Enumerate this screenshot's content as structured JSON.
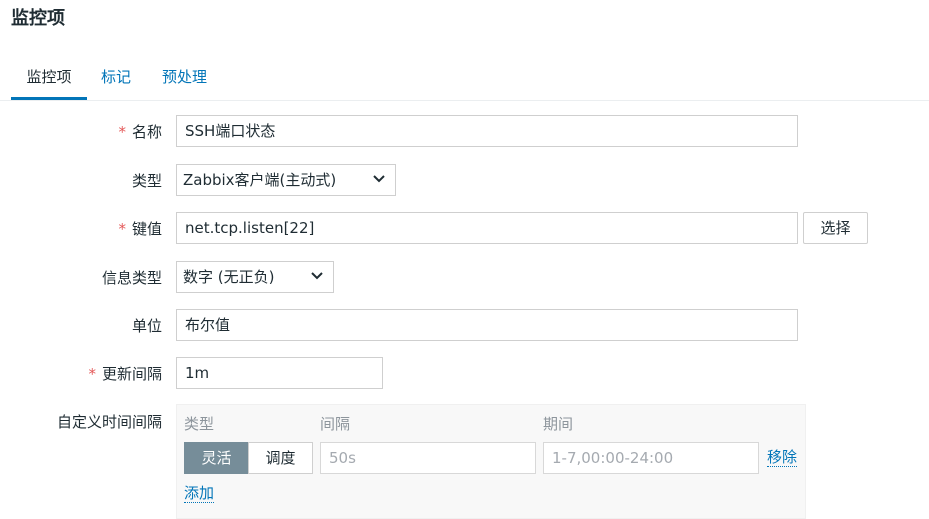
{
  "page": {
    "title": "监控项"
  },
  "tabs": [
    {
      "label": "监控项",
      "active": true
    },
    {
      "label": "标记",
      "active": false
    },
    {
      "label": "预处理",
      "active": false
    }
  ],
  "form": {
    "required_mark": "*",
    "name": {
      "label": "名称",
      "value": "SSH端口状态"
    },
    "type": {
      "label": "类型",
      "value": "Zabbix客户端(主动式)"
    },
    "key": {
      "label": "键值",
      "value": "net.tcp.listen[22]",
      "select_button": "选择"
    },
    "info_type": {
      "label": "信息类型",
      "value": "数字 (无正负)"
    },
    "units": {
      "label": "单位",
      "value": "布尔值"
    },
    "update_interval": {
      "label": "更新间隔",
      "value": "1m"
    },
    "custom_intervals": {
      "label": "自定义时间间隔",
      "headers": {
        "type": "类型",
        "interval": "间隔",
        "period": "期间"
      },
      "row": {
        "mode_flexible": "灵活",
        "mode_scheduling": "调度",
        "interval_placeholder": "50s",
        "period_placeholder": "1-7,00:00-24:00",
        "remove_link": "移除"
      },
      "add_link": "添加"
    }
  },
  "colors": {
    "accent": "#0275b8",
    "required": "#e45959",
    "segment_active": "#768d99"
  }
}
